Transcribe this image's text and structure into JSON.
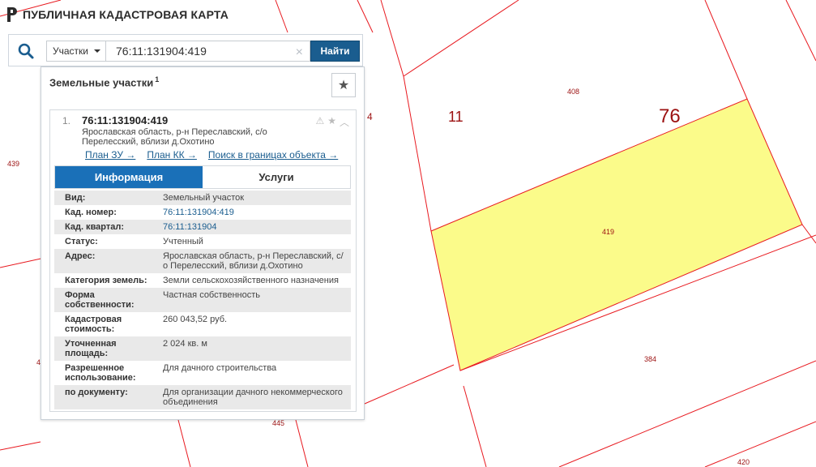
{
  "header": {
    "title": "ПУБЛИЧНАЯ КАДАСТРОВАЯ КАРТА"
  },
  "search": {
    "type_label": "Участки",
    "query": "76:11:131904:419",
    "find_label": "Найти"
  },
  "panel": {
    "title": "Земельные участки",
    "count_sup": "1",
    "result": {
      "index": "1.",
      "cad_number": "76:11:131904:419",
      "address": "Ярославская область, р-н Переславский, с/о Перелесский, вблизи д.Охотино",
      "links": [
        "План ЗУ →",
        "План КК →",
        "Поиск в границах объекта →"
      ],
      "tabs": [
        "Информация",
        "Услуги"
      ],
      "rows": [
        {
          "label": "Вид:",
          "value": "Земельный участок"
        },
        {
          "label": "Кад. номер:",
          "value": "76:11:131904:419"
        },
        {
          "label": "Кад. квартал:",
          "value": "76:11:131904"
        },
        {
          "label": "Статус:",
          "value": "Учтенный"
        },
        {
          "label": "Адрес:",
          "value": "Ярославская область, р-н Переславский, с/о Перелесский, вблизи д.Охотино"
        },
        {
          "label": "Категория земель:",
          "value": "Земли сельскохозяйственного назначения"
        },
        {
          "label": "Форма собственности:",
          "value": "Частная собственность"
        },
        {
          "label": "Кадастровая стоимость:",
          "value": "260 043,52 руб."
        },
        {
          "label": "Уточненная площадь:",
          "value": "2 024 кв. м"
        },
        {
          "label": "Разрешенное использование:",
          "value": "Для дачного строительства"
        },
        {
          "label": "по документу:",
          "value": "Для организации дачного некоммерческого объединения"
        }
      ]
    }
  },
  "map": {
    "labels": {
      "region": "76",
      "district": "11",
      "p408": "408",
      "p419": "419",
      "p384": "384",
      "p439": "439",
      "p445": "445",
      "p420": "420",
      "p4a": "4",
      "p4b": "4"
    },
    "colors": {
      "parcel_fill": "#fbfb8a",
      "boundary": "#e8191f"
    }
  }
}
